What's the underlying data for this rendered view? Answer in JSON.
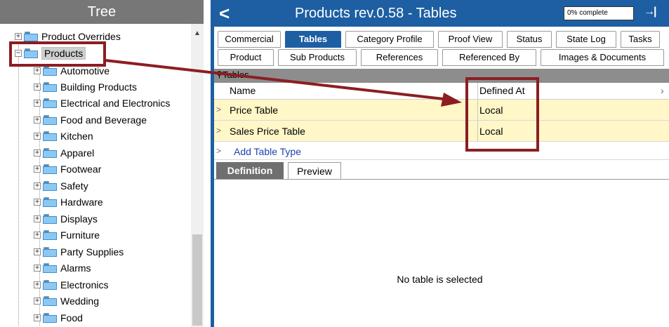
{
  "tree": {
    "title": "Tree",
    "items": [
      {
        "label": "Product Overrides",
        "level": 1
      },
      {
        "label": "Products",
        "level": 1,
        "selected": true
      },
      {
        "label": "Automotive",
        "level": 2
      },
      {
        "label": "Building Products",
        "level": 2
      },
      {
        "label": "Electrical and Electronics",
        "level": 2
      },
      {
        "label": "Food and Beverage",
        "level": 2
      },
      {
        "label": "Kitchen",
        "level": 2
      },
      {
        "label": "Apparel",
        "level": 2
      },
      {
        "label": "Footwear",
        "level": 2
      },
      {
        "label": "Safety",
        "level": 2
      },
      {
        "label": "Hardware",
        "level": 2
      },
      {
        "label": "Displays",
        "level": 2
      },
      {
        "label": "Furniture",
        "level": 2
      },
      {
        "label": "Party Supplies",
        "level": 2
      },
      {
        "label": "Alarms",
        "level": 2
      },
      {
        "label": "Electronics",
        "level": 2
      },
      {
        "label": "Wedding",
        "level": 2
      },
      {
        "label": "Food",
        "level": 2
      }
    ]
  },
  "document": {
    "title": "Products rev.0.58 - Tables",
    "progress_text": "0% complete",
    "tabs_row1": [
      "Commercial",
      "Tables",
      "Category Profile",
      "Proof View",
      "Status",
      "State Log",
      "Tasks"
    ],
    "tabs_row2": [
      "Product",
      "Sub Products",
      "References",
      "Referenced By",
      "Images & Documents"
    ],
    "active_tab": "Tables"
  },
  "tables": {
    "caption": "Tables",
    "columns": [
      "Name",
      "Defined At"
    ],
    "rows": [
      {
        "name": "Price Table",
        "defined_at": "Local"
      },
      {
        "name": "Sales Price Table",
        "defined_at": "Local"
      }
    ],
    "add_label": "Add Table Type"
  },
  "lower_tabs": {
    "definition": "Definition",
    "preview": "Preview",
    "empty_message": "No table is selected"
  },
  "colors": {
    "header_blue": "#1d5fa2",
    "annotation_red": "#8b1e22",
    "row_highlight": "#fff7c8"
  }
}
